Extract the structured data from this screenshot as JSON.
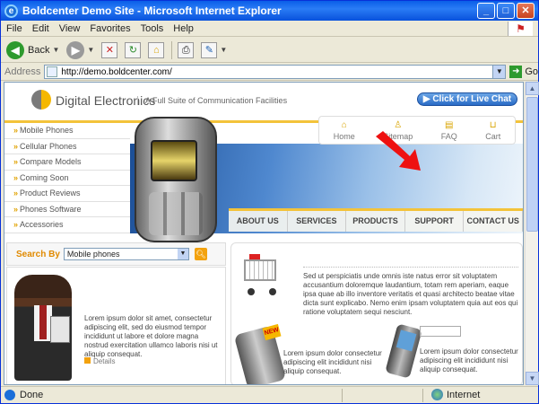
{
  "window": {
    "title": "Boldcenter Demo Site - Microsoft Internet Explorer"
  },
  "menu": [
    "File",
    "Edit",
    "View",
    "Favorites",
    "Tools",
    "Help"
  ],
  "toolbar": {
    "back_label": "Back"
  },
  "address": {
    "label": "Address",
    "url": "http://demo.boldcenter.com/",
    "go_label": "Go"
  },
  "page": {
    "brand": "Digital Electronics",
    "tagline": "A Full Suite of Communication Facilities",
    "livechat": "Click for Live Chat",
    "quicknav": [
      "Home",
      "Sitemap",
      "FAQ",
      "Cart"
    ],
    "leftnav": [
      "Mobile Phones",
      "Cellular Phones",
      "Compare Models",
      "Coming Soon",
      "Product Reviews",
      "Phones Software",
      "Accessories"
    ],
    "topnav": [
      "ABOUT US",
      "SERVICES",
      "PRODUCTS",
      "SUPPORT",
      "CONTACT US"
    ],
    "search": {
      "label": "Search By",
      "value": "Mobile phones"
    },
    "feature": {
      "text": "Lorem ipsum dolor sit amet, consectetur adipiscing elit, sed do eiusmod tempor incididunt ut labore et dolore magna nostrud exercitation ullamco laboris nisi ut aliquip consequat.",
      "details": "Details"
    },
    "promo1": "Sed ut perspiciatis unde omnis iste natus error sit voluptatem accusantium doloremque laudantium, totam rem aperiam, eaque ipsa quae ab illo inventore veritatis et quasi architecto beatae vitae dicta sunt explicabo. Nemo enim ipsam voluptatem quia aut eos qui ratione voluptatem sequi nesciunt.",
    "promo2": "Lorem ipsum dolor consectetur adipiscing elit incididunt nisi aliquip consequat.",
    "promo3": "Lorem ipsum dolor consectetur adipiscing elit incididunt nisi aliquip consequat.",
    "new_badge": "NEW"
  },
  "status": {
    "text": "Done",
    "zone": "Internet"
  }
}
